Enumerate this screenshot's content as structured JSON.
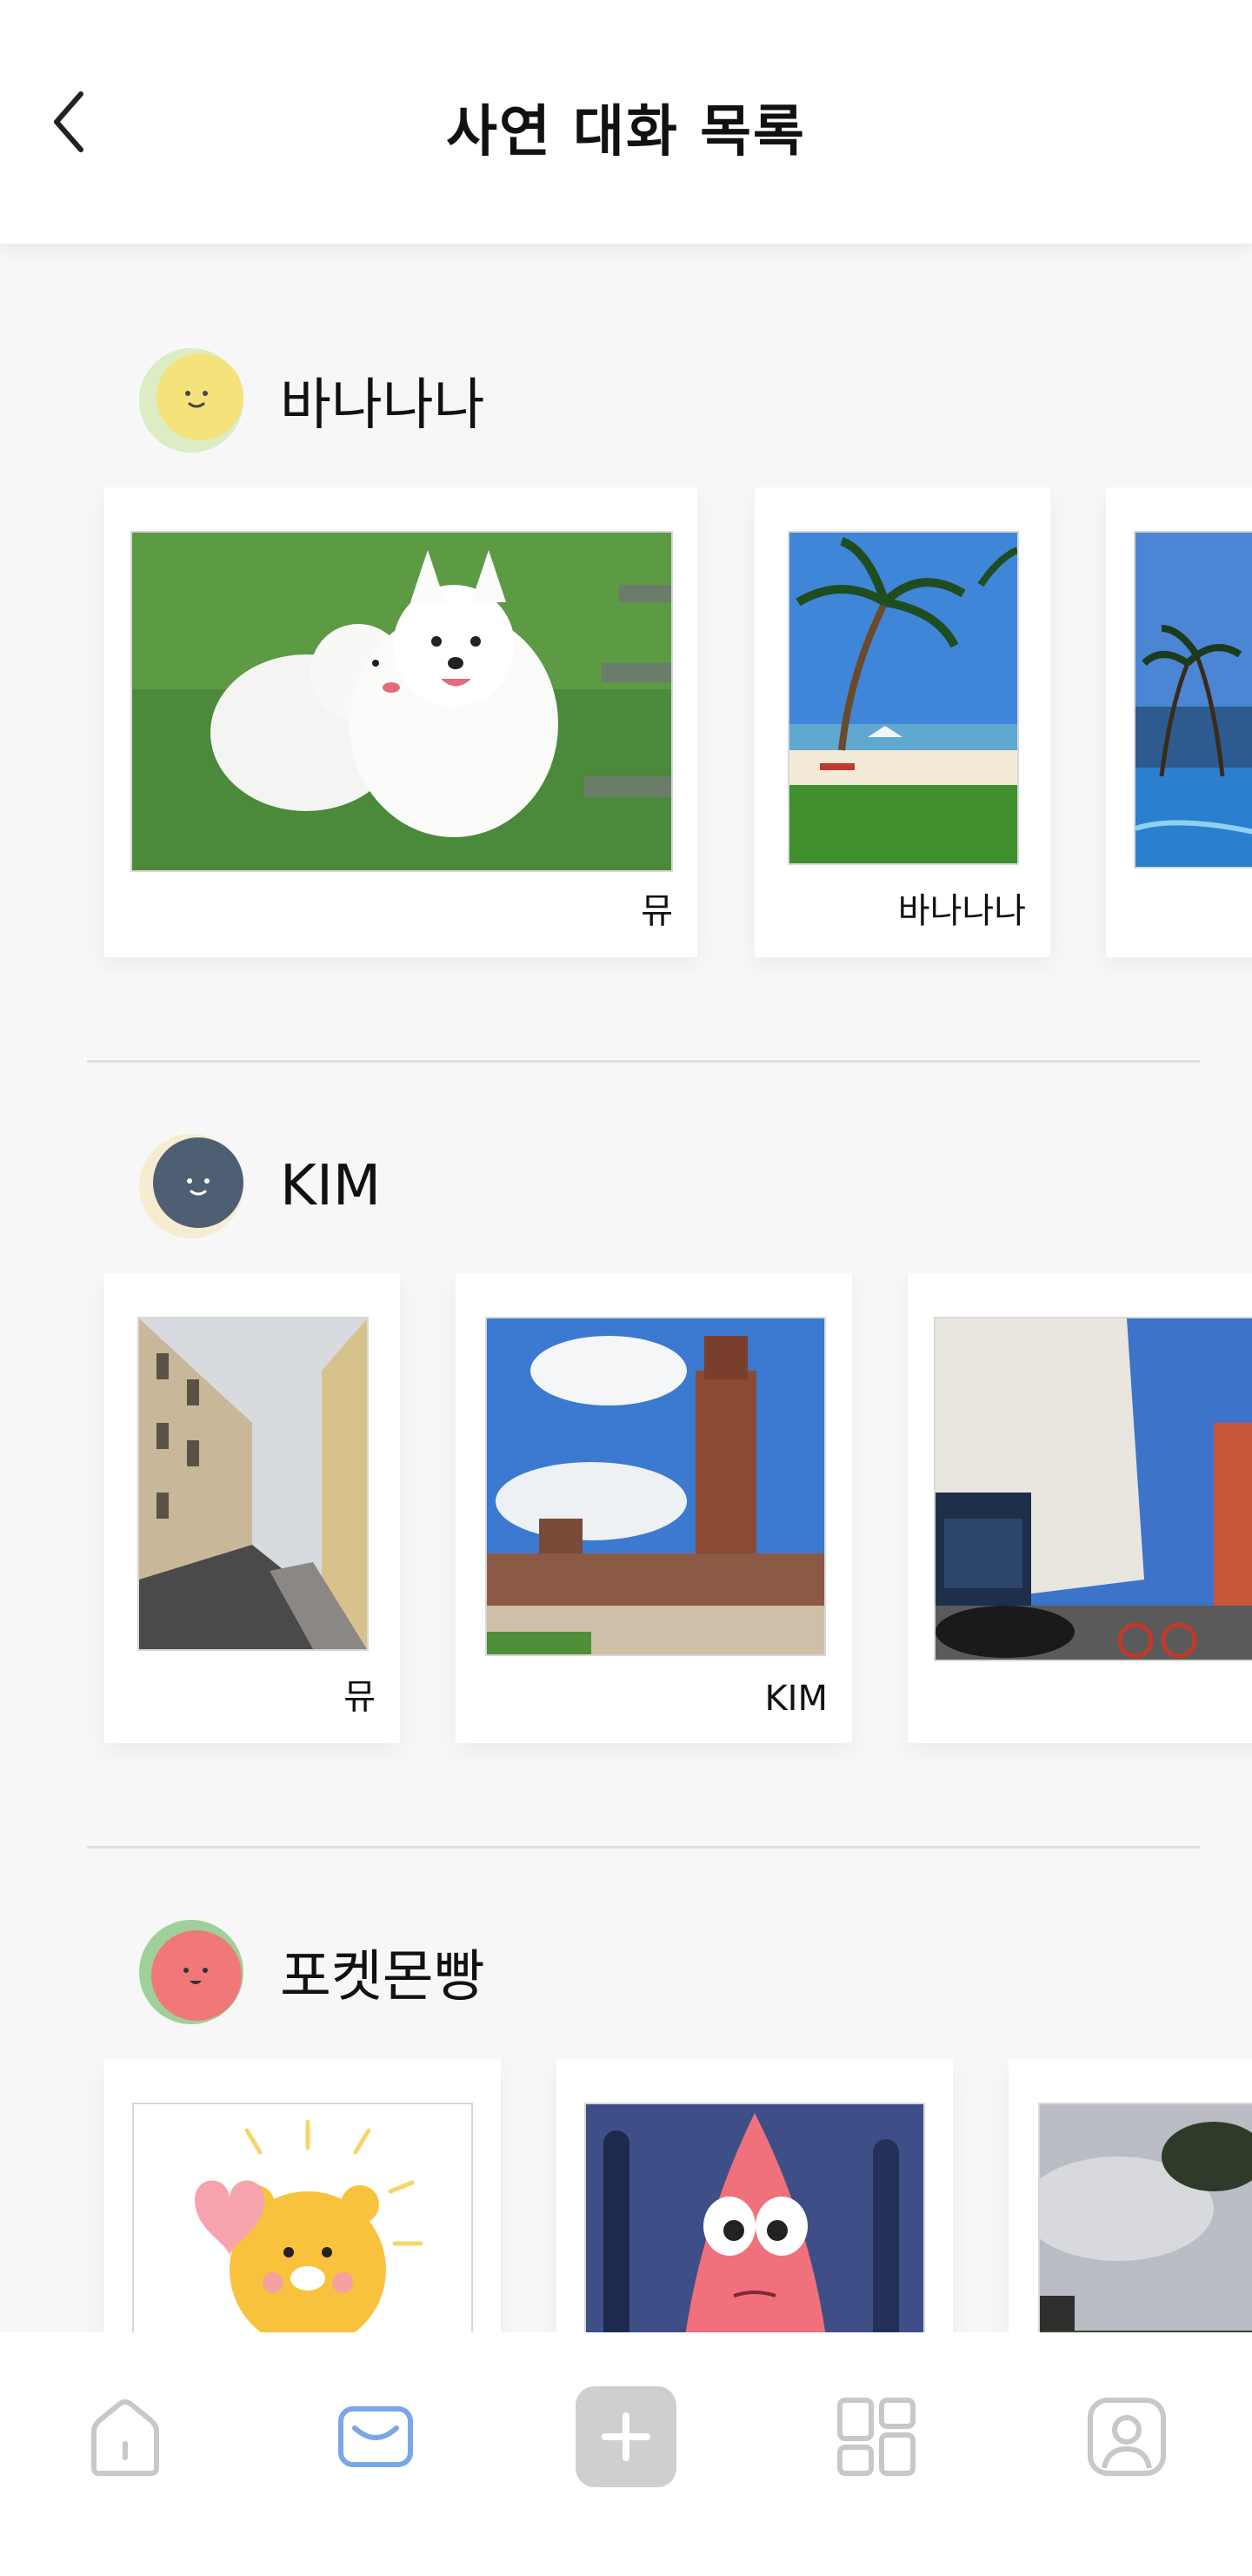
{
  "header": {
    "title": "사연 대화 목록",
    "back_icon": "chevron-left-icon"
  },
  "sections": [
    {
      "name": "바나나나",
      "avatar_colors": {
        "back": "#dcecc4",
        "face": "#f6e27a"
      },
      "cards": [
        {
          "photo": "samoyed-dogs-photo",
          "owner": "뮤"
        },
        {
          "photo": "palm-beach-photo",
          "owner": "바나나나"
        },
        {
          "photo": "resort-pool-photo",
          "owner": ""
        }
      ]
    },
    {
      "name": "KIM",
      "avatar_colors": {
        "back": "#f6ecd2",
        "face": "#4f5f73"
      },
      "cards": [
        {
          "photo": "paris-street-photo",
          "owner": "뮤"
        },
        {
          "photo": "castle-tower-photo",
          "owner": "KIM"
        },
        {
          "photo": "london-street-photo",
          "owner": ""
        }
      ]
    },
    {
      "name": "포켓몬빵",
      "avatar_colors": {
        "back": "#9fd09a",
        "face": "#f07878"
      },
      "cards": [
        {
          "photo": "cartoon-bear-heart-photo",
          "owner": ""
        },
        {
          "photo": "cartoon-starfish-photo",
          "owner": ""
        },
        {
          "photo": "cloudy-sky-photo",
          "owner": ""
        }
      ]
    }
  ],
  "bottom_nav": {
    "items": [
      {
        "icon": "home-icon",
        "active": false
      },
      {
        "icon": "message-icon",
        "active": true
      },
      {
        "icon": "add-icon",
        "active": false
      },
      {
        "icon": "grid-icon",
        "active": false
      },
      {
        "icon": "profile-icon",
        "active": false
      }
    ],
    "active_color": "#7aa7e8",
    "inactive_color": "#c8c8c8"
  }
}
